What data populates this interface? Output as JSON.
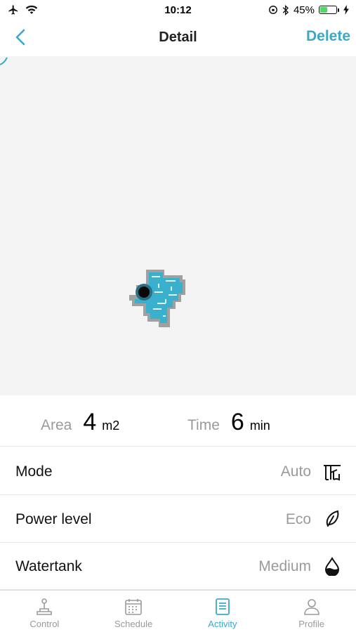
{
  "status_bar": {
    "time": "10:12",
    "battery": "45%",
    "battery_level": 0.45
  },
  "nav": {
    "title": "Detail",
    "delete_label": "Delete"
  },
  "stats": {
    "area_label": "Area",
    "area_value": "4",
    "area_unit": "m2",
    "time_label": "Time",
    "time_value": "6",
    "time_unit": "min"
  },
  "settings": [
    {
      "label": "Mode",
      "value": "Auto",
      "icon": "auto-mode-icon"
    },
    {
      "label": "Power level",
      "value": "Eco",
      "icon": "leaf-icon"
    },
    {
      "label": "Watertank",
      "value": "Medium",
      "icon": "water-drop-icon"
    }
  ],
  "tabs": [
    {
      "label": "Control",
      "icon": "joystick-icon",
      "active": false
    },
    {
      "label": "Schedule",
      "icon": "calendar-icon",
      "active": false
    },
    {
      "label": "Activity",
      "icon": "document-icon",
      "active": true
    },
    {
      "label": "Profile",
      "icon": "person-icon",
      "active": false
    }
  ],
  "colors": {
    "accent": "#3aa9c8",
    "map_background": "#f4f4f4",
    "cleaned_area": "#3ab0cf",
    "map_border": "#9e9e9e"
  }
}
